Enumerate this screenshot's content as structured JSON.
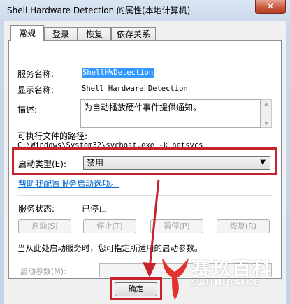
{
  "window": {
    "title": "Shell Hardware Detection 的属性(本地计算机)",
    "close_glyph": "✕"
  },
  "tabs": [
    {
      "label": "常规",
      "active": true
    },
    {
      "label": "登录",
      "active": false
    },
    {
      "label": "恢复",
      "active": false
    },
    {
      "label": "依存关系",
      "active": false
    }
  ],
  "general": {
    "service_name_label": "服务名称:",
    "service_name_value": "ShellHWDetection",
    "display_name_label": "显示名称:",
    "display_name_value": "Shell Hardware Detection",
    "description_label": "描述:",
    "description_value": "为自动播放硬件事件提供通知。",
    "exe_path_label": "可执行文件的路径:",
    "exe_path_value": "C:\\Windows\\System32\\svchost.exe -k netsvcs",
    "startup_type_label": "启动类型(E):",
    "startup_type_value": "禁用",
    "help_link": "帮助我配置服务启动选项。",
    "status_label": "服务状态:",
    "status_value": "已停止",
    "buttons": {
      "start": "启动(S)",
      "stop": "停止(T)",
      "pause": "暂停(P)",
      "resume": "恢复(R)"
    },
    "hint_text": "当从此处启动服务时，您可指定所适用的启动参数。",
    "params_label": "启动参数(M):",
    "params_value": ""
  },
  "footer": {
    "ok_label": "确定"
  },
  "watermark": {
    "cn": "赛玖百科",
    "en": "SAIJIUBAIKE"
  },
  "colors": {
    "highlight_red": "#c8232c",
    "watermark_red": "#e2342c",
    "link_blue": "#0066cc"
  }
}
